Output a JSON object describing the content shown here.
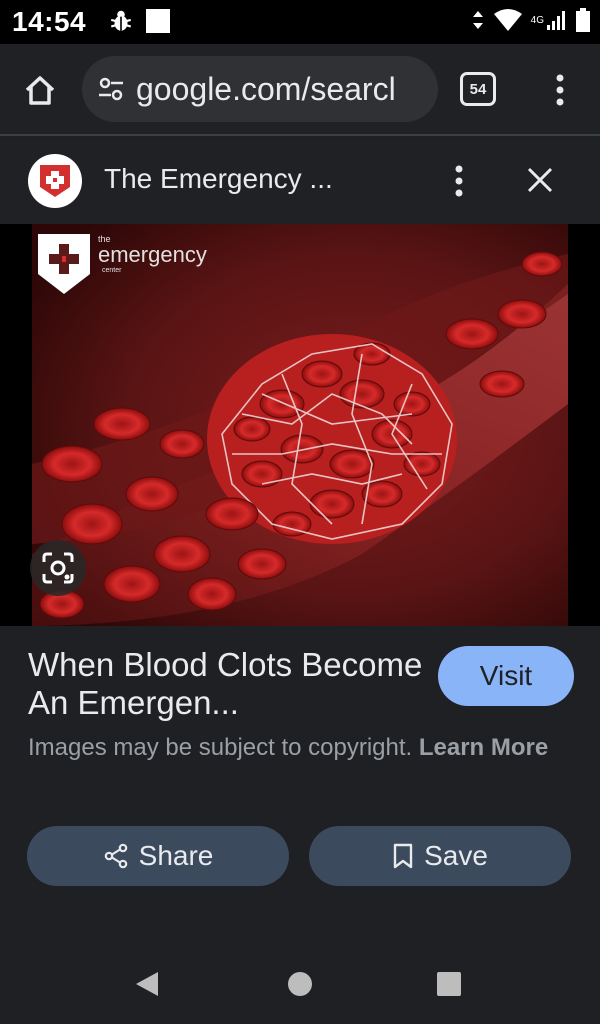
{
  "status_bar": {
    "time": "14:54",
    "network": "4G",
    "icons": [
      "bug-icon",
      "square-icon",
      "wifi-icon",
      "signal-icon",
      "battery-icon"
    ]
  },
  "browser": {
    "url": "google.com/searcl",
    "tab_count": "54",
    "icons": [
      "home-icon",
      "site-settings-icon",
      "more-vert-icon"
    ]
  },
  "result": {
    "site_title": "The Emergency ...",
    "image_logo_text": [
      "the",
      "emergency",
      "center"
    ],
    "headline": "When Blood Clots Become An Emergen...",
    "visit_label": "Visit",
    "copyright_text": "Images may be subject to copyright.",
    "learn_more_label": "Learn More"
  },
  "actions": {
    "share_label": "Share",
    "save_label": "Save"
  },
  "colors": {
    "background": "#1f2023",
    "visit_button": "#8ab4f8",
    "action_button": "#3c4a5e",
    "brand_red": "#d32f2f"
  }
}
